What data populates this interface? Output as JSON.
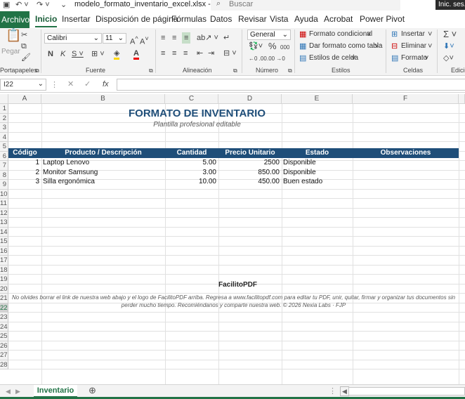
{
  "titlebar": {
    "filename": "modelo_formato_inventario_excel.xlsx  -  Excel",
    "search_placeholder": "Buscar",
    "signin": "Inic. ses."
  },
  "tabs": [
    "Archivo",
    "Inicio",
    "Insertar",
    "Disposición de página",
    "Fórmulas",
    "Datos",
    "Revisar",
    "Vista",
    "Ayuda",
    "Acrobat",
    "Power Pivot"
  ],
  "ribbon": {
    "paste_label": "Pegar",
    "font_name": "Calibri",
    "font_size": "11",
    "number_format": "General",
    "conditional_format": "Formato condicional",
    "format_as_table": "Dar formato como tabla",
    "cell_styles": "Estilos de celda",
    "insert": "Insertar",
    "delete": "Eliminar",
    "format": "Formato",
    "groups": [
      "Portapapeles",
      "Fuente",
      "Alineación",
      "Número",
      "Estilos",
      "Celdas",
      "Edición"
    ]
  },
  "formula_bar": {
    "name_box": "I22",
    "fx": "fx"
  },
  "columns": [
    "A",
    "B",
    "C",
    "D",
    "E",
    "F"
  ],
  "rows": [
    "1",
    "2",
    "3",
    "4",
    "5",
    "6",
    "7",
    "8",
    "9",
    "10",
    "11",
    "12",
    "13",
    "14",
    "15",
    "16",
    "17",
    "18",
    "19",
    "20",
    "21",
    "22",
    "23",
    "24",
    "25",
    "26",
    "27",
    "28"
  ],
  "sheet": {
    "title": "FORMATO DE INVENTARIO",
    "subtitle": "Plantilla profesional editable",
    "headers": [
      "Código",
      "Producto / Descripción",
      "Cantidad",
      "Precio Unitario",
      "Estado",
      "Observaciones"
    ],
    "items": [
      {
        "code": "1",
        "product": "Laptop Lenovo",
        "qty": "5.00",
        "price": "2500",
        "status": "Disponible"
      },
      {
        "code": "2",
        "product": "Monitor Samsung",
        "qty": "3.00",
        "price": "850.00",
        "status": "Disponible"
      },
      {
        "code": "3",
        "product": "Silla ergonómica",
        "qty": "10.00",
        "price": "450.00",
        "status": "Buen estado"
      }
    ],
    "brand": "FacilitoPDF",
    "note": "No olvides borrar el link de nuestra web abajo y el logo de FacilitoPDF arriba. Regresa a www.facilitopdf.com para editar tu PDF, unir, quitar, firmar y organizar tus documentos sin perder mucho tiempo. Recomiéndanos y comparte nuestra web. © 2026 Nexia Labs · FJP"
  },
  "sheet_tab": "Inventario",
  "colors": {
    "excel_green": "#217346",
    "header_blue": "#1f4e79"
  }
}
